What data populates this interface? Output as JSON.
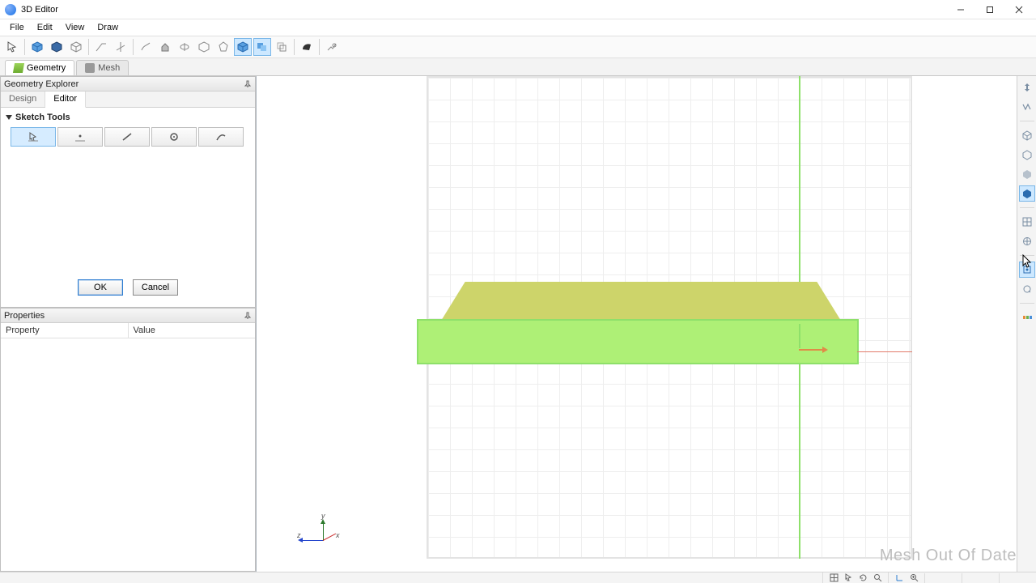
{
  "window": {
    "title": "3D Editor"
  },
  "menus": {
    "file": "File",
    "edit": "Edit",
    "view": "View",
    "draw": "Draw"
  },
  "mode_tabs": {
    "geometry": "Geometry",
    "mesh": "Mesh"
  },
  "explorer": {
    "panel_title": "Geometry Explorer",
    "subtabs": {
      "design": "Design",
      "editor": "Editor"
    },
    "section_title": "Sketch Tools",
    "buttons": {
      "ok": "OK",
      "cancel": "Cancel"
    }
  },
  "properties": {
    "panel_title": "Properties",
    "columns": {
      "property": "Property",
      "value": "Value"
    }
  },
  "viewport": {
    "triad": {
      "x": "x",
      "y": "y",
      "z": "z"
    },
    "watermark": "Mesh Out Of Date"
  },
  "colors": {
    "accent": "#2a7bd1",
    "shape_top": "#cdd46a",
    "shape_front": "#aef076",
    "grid_line": "#eeeeee"
  }
}
